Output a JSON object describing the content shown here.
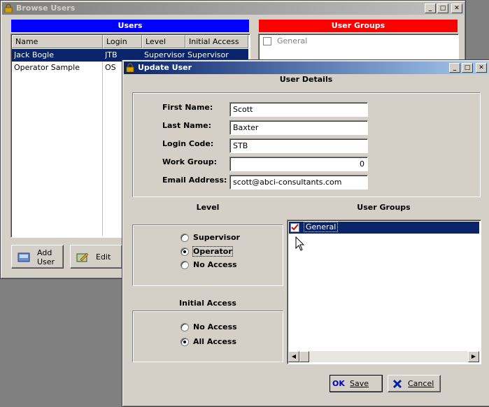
{
  "browse_window": {
    "title": "Browse Users",
    "users_header": "Users",
    "groups_header": "User Groups",
    "columns": [
      "Name",
      "Login",
      "Level",
      "Initial Access"
    ],
    "rows": [
      {
        "name": "Jack Bogle",
        "login": "JTB",
        "level": "Supervisor",
        "access": "Supervisor"
      },
      {
        "name": "Operator Sample",
        "login": "OS",
        "level": "",
        "access": ""
      }
    ],
    "groups": [
      {
        "label": "General"
      }
    ],
    "add_user_label": "Add\nUser",
    "add_line1": "Add",
    "add_line2": "User",
    "edit_label": "Edit"
  },
  "update_window": {
    "title": "Update User",
    "user_details_label": "User Details",
    "fields": {
      "first_name_label": "First Name:",
      "first_name": "Scott",
      "last_name_label": "Last Name:",
      "last_name": "Baxter",
      "login_code_label": "Login Code:",
      "login_code": "STB",
      "work_group_label": "Work Group:",
      "work_group": "0",
      "email_label": "Email Address:",
      "email": "scott@abci-consultants.com"
    },
    "level_label": "Level",
    "level_options": [
      "Supervisor",
      "Operator",
      "No Access"
    ],
    "level_selected": "Operator",
    "initial_access_label": "Initial Access",
    "access_options": [
      "No Access",
      "All Access"
    ],
    "access_selected": "All Access",
    "user_groups_label": "User Groups",
    "user_groups": [
      {
        "label": "General",
        "checked": true
      }
    ],
    "save_ok": "OK",
    "save_label": "Save",
    "cancel_label": "Cancel"
  },
  "colors": {
    "users_header": "#0000ff",
    "groups_header": "#ff0000",
    "selection": "#0a246a",
    "window_bg": "#d4d0c8"
  }
}
